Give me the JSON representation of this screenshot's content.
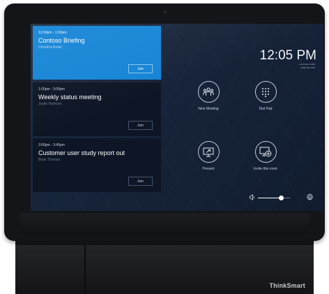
{
  "device": {
    "brand": "ThinkSmart"
  },
  "meetings": [
    {
      "time": "12:00pm - 1:00pm",
      "title": "Contoso Briefing",
      "organizer": "Christina Butler",
      "action": "Join",
      "active": true
    },
    {
      "time": "1:00pm - 3:00pm",
      "title": "Weekly status meeting",
      "organizer": "Justin Harrison",
      "action": "Join",
      "active": false
    },
    {
      "time": "3:00pm - 3:45pm",
      "title": "Customer user study report out",
      "organizer": "Brian Thomas",
      "action": "Join",
      "active": false
    }
  ],
  "status": {
    "clock": "12:05 PM",
    "room_name": "Conf Room 3456",
    "room_phone": "(555) 555-1796"
  },
  "actions": [
    {
      "label": "New Meeting",
      "icon": "people-group-icon"
    },
    {
      "label": "Dial Pad",
      "icon": "dial-pad-icon"
    },
    {
      "label": "Present",
      "icon": "present-screen-icon"
    },
    {
      "label": "Invite this room",
      "icon": "invite-room-icon"
    }
  ],
  "volume": {
    "level": 0.72,
    "icon": "speaker-icon"
  },
  "settings": {
    "icon": "gear-icon"
  },
  "colors": {
    "accent": "#1685d6",
    "card": "#0e1626",
    "screen_bg": "#16233a"
  }
}
